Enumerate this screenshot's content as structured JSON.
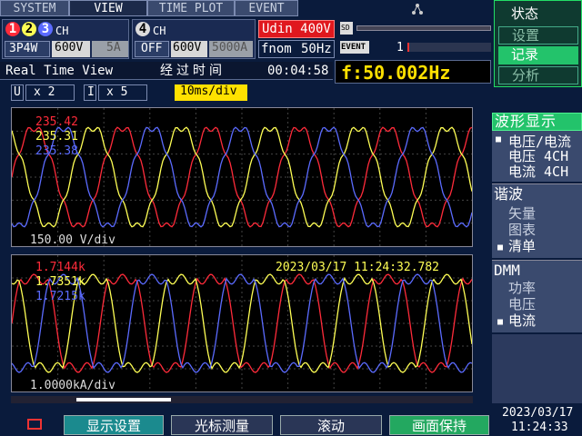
{
  "tabs": {
    "system": "SYSTEM",
    "view": "VIEW",
    "time_plot": "TIME PLOT",
    "event": "EVENT"
  },
  "channels": {
    "group_digits": [
      "1",
      "2",
      "3"
    ],
    "group_ch": "CH",
    "wiring": "3P4W",
    "voltage_range": "600V",
    "current_range": "5A",
    "ch4_digit": "4",
    "ch4_ch": "CH",
    "ch4_state": "OFF",
    "ch4_voltage_range": "600V",
    "ch4_current_range": "5000A"
  },
  "nominal": {
    "udin": "Udin 400V",
    "fnom": "fnom",
    "fnom_value": "50Hz"
  },
  "status_bar": {
    "sd_label": "SD",
    "event_label": "EVENT",
    "event_count": "1"
  },
  "status_menu": {
    "title": "状态",
    "items": [
      "设置",
      "记录",
      "分析"
    ],
    "selected_index": 1
  },
  "info_row": {
    "view_name": "Real Time View",
    "elapsed_label": "经过时间",
    "elapsed_time": "00:04:58",
    "freq_text": "f:50.002Hz"
  },
  "scale_row": {
    "u_label": "U",
    "u_scale": "x 2",
    "i_label": "I",
    "i_scale": "x 5",
    "time_div": "10ms/div"
  },
  "upper_plot": {
    "readouts": [
      "235.42",
      "235.31",
      "235.38"
    ],
    "div_label": "150.00 V/div"
  },
  "lower_plot": {
    "readouts": [
      "1.7144k",
      "1.7351k",
      "1.7215k"
    ],
    "timestamp": "2023/03/17 11:24:32.782",
    "div_label": "1.0000kA/div"
  },
  "side_menu": {
    "waveform_title": "波形显示",
    "waveform_items": [
      "电压/电流",
      "电压 4CH",
      "电流 4CH"
    ],
    "harmonic_title": "谐波",
    "harmonic_items": [
      "矢量",
      "图表",
      "清单"
    ],
    "dmm_title": "DMM",
    "dmm_items": [
      "功率",
      "电压",
      "电流"
    ]
  },
  "bottom_bar": {
    "buttons": [
      "显示设置",
      "光标测量",
      "滚动",
      "画面保持"
    ],
    "date": "2023/03/17",
    "time": "11:24:33"
  },
  "colors": {
    "phase1": "#ff2b3a",
    "phase2": "#ffff55",
    "phase3": "#5b6bff",
    "accent_green": "#23c36b",
    "freq_yellow": "#ffe100"
  }
}
